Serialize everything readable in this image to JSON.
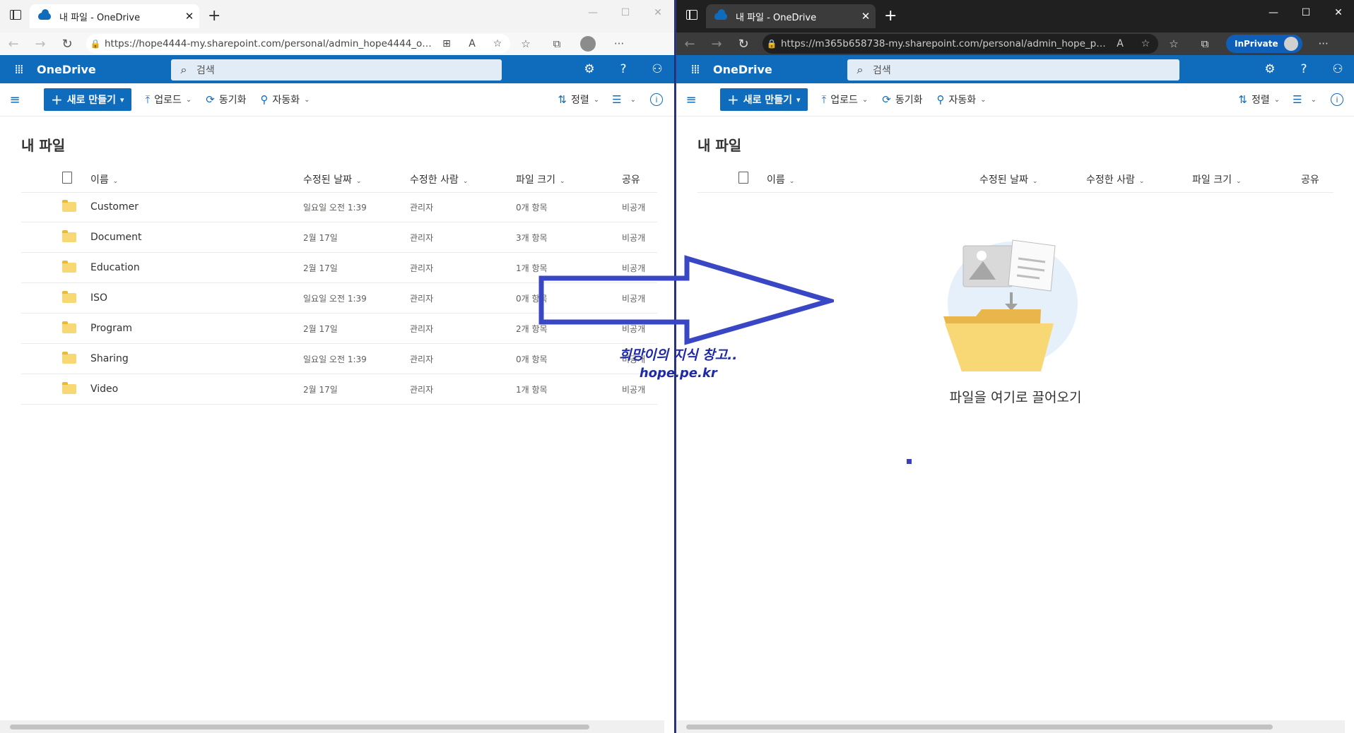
{
  "left": {
    "tab_title": "내 파일 - OneDrive",
    "url": "https://hope4444-my.sharepoint.com/personal/admin_hope4444_onmicr...",
    "app_name": "OneDrive",
    "search_placeholder": "검색",
    "new_button": "새로 만들기",
    "upload": "업로드",
    "sync": "동기화",
    "automate": "자동화",
    "sort": "정렬",
    "page_title": "내 파일",
    "columns": {
      "name": "이름",
      "modified": "수정된 날짜",
      "modified_by": "수정한 사람",
      "size": "파일 크기",
      "sharing": "공유"
    },
    "rows": [
      {
        "name": "Customer",
        "modified": "일요일 오전 1:39",
        "modified_by": "관리자",
        "size": "0개 항목",
        "sharing": "비공개"
      },
      {
        "name": "Document",
        "modified": "2월 17일",
        "modified_by": "관리자",
        "size": "3개 항목",
        "sharing": "비공개"
      },
      {
        "name": "Education",
        "modified": "2월 17일",
        "modified_by": "관리자",
        "size": "1개 항목",
        "sharing": "비공개"
      },
      {
        "name": "ISO",
        "modified": "일요일 오전 1:39",
        "modified_by": "관리자",
        "size": "0개 항목",
        "sharing": "비공개"
      },
      {
        "name": "Program",
        "modified": "2월 17일",
        "modified_by": "관리자",
        "size": "2개 항목",
        "sharing": "비공개"
      },
      {
        "name": "Sharing",
        "modified": "일요일 오전 1:39",
        "modified_by": "관리자",
        "size": "0개 항목",
        "sharing": "비공개"
      },
      {
        "name": "Video",
        "modified": "2월 17일",
        "modified_by": "관리자",
        "size": "1개 항목",
        "sharing": "비공개"
      }
    ]
  },
  "right": {
    "tab_title": "내 파일 - OneDrive",
    "url": "https://m365b658738-my.sharepoint.com/personal/admin_hope_pe_...",
    "inprivate": "InPrivate",
    "app_name": "OneDrive",
    "search_placeholder": "검색",
    "new_button": "새로 만들기",
    "upload": "업로드",
    "sync": "동기화",
    "automate": "자동화",
    "sort": "정렬",
    "page_title": "내 파일",
    "columns": {
      "name": "이름",
      "modified": "수정된 날짜",
      "modified_by": "수정한 사람",
      "size": "파일 크기",
      "sharing": "공유"
    },
    "empty_text": "파일을 여기로 끌어오기"
  },
  "watermark": {
    "line1": "희망이의 지식 창고..",
    "line2": "hope.pe.kr"
  },
  "colors": {
    "accent": "#0f6cbd",
    "arrow": "#3a47c4",
    "folder": "#f8d775"
  },
  "icons": [
    "waffle-icon",
    "search-icon",
    "gear-icon",
    "help-icon",
    "person-icon",
    "hamburger-icon",
    "upload-icon",
    "sync-icon",
    "automate-icon",
    "sort-icon",
    "view-icon",
    "info-icon",
    "file-icon",
    "folder-icon",
    "cloud-icon"
  ]
}
